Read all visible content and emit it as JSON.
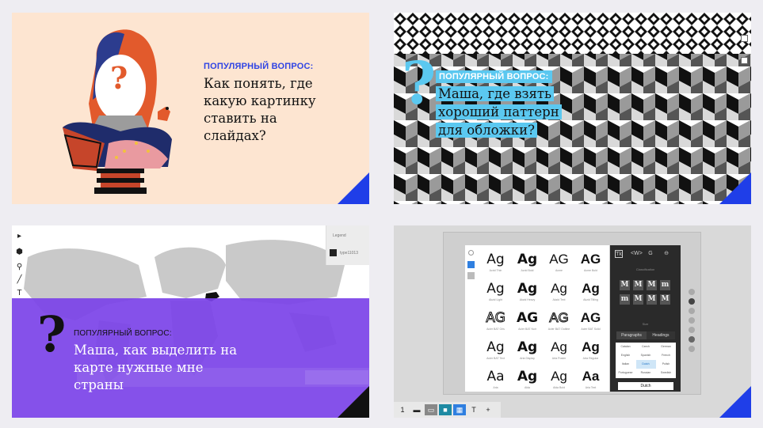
{
  "cards": [
    {
      "kicker": "ПОПУЛЯРНЫЙ ВОПРОС:",
      "headline": "Как понять, где какую картинку ставить на слайдах?",
      "question_glyph": "?"
    },
    {
      "kicker": "ПОПУЛЯРНЫЙ ВОПРОС:",
      "headline": "Маша, где взять хороший паттерн для обложки?",
      "question_glyph": "?"
    },
    {
      "kicker": "ПОПУЛЯРНЫЙ ВОПРОС:",
      "headline": "Маша, как выделить на карте нужные мне страны",
      "question_glyph": "?",
      "legend": {
        "title": "Legend",
        "label": "type11013"
      },
      "tools": [
        "▸",
        "⬢",
        "⚲",
        "╱",
        "T"
      ]
    },
    {
      "font_cells": [
        {
          "glyph": "Ag",
          "name": "Acrid Thin"
        },
        {
          "glyph": "Ag",
          "name": "Acrid Bold"
        },
        {
          "glyph": "AG",
          "name": "Acme"
        },
        {
          "glyph": "AG",
          "name": "Acme Bold"
        },
        {
          "glyph": "Ag",
          "name": "Akzid Light"
        },
        {
          "glyph": "Ag",
          "name": "Akzid Heavy"
        },
        {
          "glyph": "Ag",
          "name": "Akzid Text"
        },
        {
          "glyph": "Ag",
          "name": "Akzid Titling"
        },
        {
          "glyph": "AG",
          "name": "Acier BAT Gris"
        },
        {
          "glyph": "AG",
          "name": "Acier BAT Noir"
        },
        {
          "glyph": "AG",
          "name": "Acier BAT Outline"
        },
        {
          "glyph": "AG",
          "name": "Acier BAT Solid"
        },
        {
          "glyph": "Ag",
          "name": "Acier BAT Text"
        },
        {
          "glyph": "Ag",
          "name": "Arta Display"
        },
        {
          "glyph": "Ag",
          "name": "Arta Poster"
        },
        {
          "glyph": "Ag",
          "name": "Arta Regular"
        },
        {
          "glyph": "Aa",
          "name": "Aria"
        },
        {
          "glyph": "Ag",
          "name": "Alda"
        },
        {
          "glyph": "Ag",
          "name": "Alda Bold"
        },
        {
          "glyph": "Aa",
          "name": "Aria Text"
        }
      ],
      "panel": {
        "tab_labels": [
          "Tk",
          "<W>",
          "G",
          "⊖"
        ],
        "classification_label": "Classification",
        "classification_buttons": [
          "M",
          "M",
          "M",
          "m",
          "m",
          "M",
          "M",
          "M"
        ],
        "size_label": "Size",
        "segments": [
          "Paragraphs",
          "Headings"
        ],
        "languages": [
          "Catalan",
          "Czech",
          "German",
          "English",
          "Spanish",
          "French",
          "Italian",
          "Dutch",
          "Polish",
          "Portuguese",
          "Russian",
          "Swedish"
        ],
        "selected_language": "Dutch",
        "dropdown_value": "Dutch"
      },
      "bottom_toolbar": [
        "1",
        "▬",
        "▭",
        "■",
        "▦",
        "T",
        "+"
      ],
      "accent_colors": {
        "blue": "#1f3ee8",
        "teal": "#1e8aa3"
      }
    }
  ],
  "colors": {
    "accent_blue": "#1f3ee8",
    "peach": "#fde5d1",
    "cyan": "#5bc8f0",
    "purple": "#7b42e8"
  }
}
